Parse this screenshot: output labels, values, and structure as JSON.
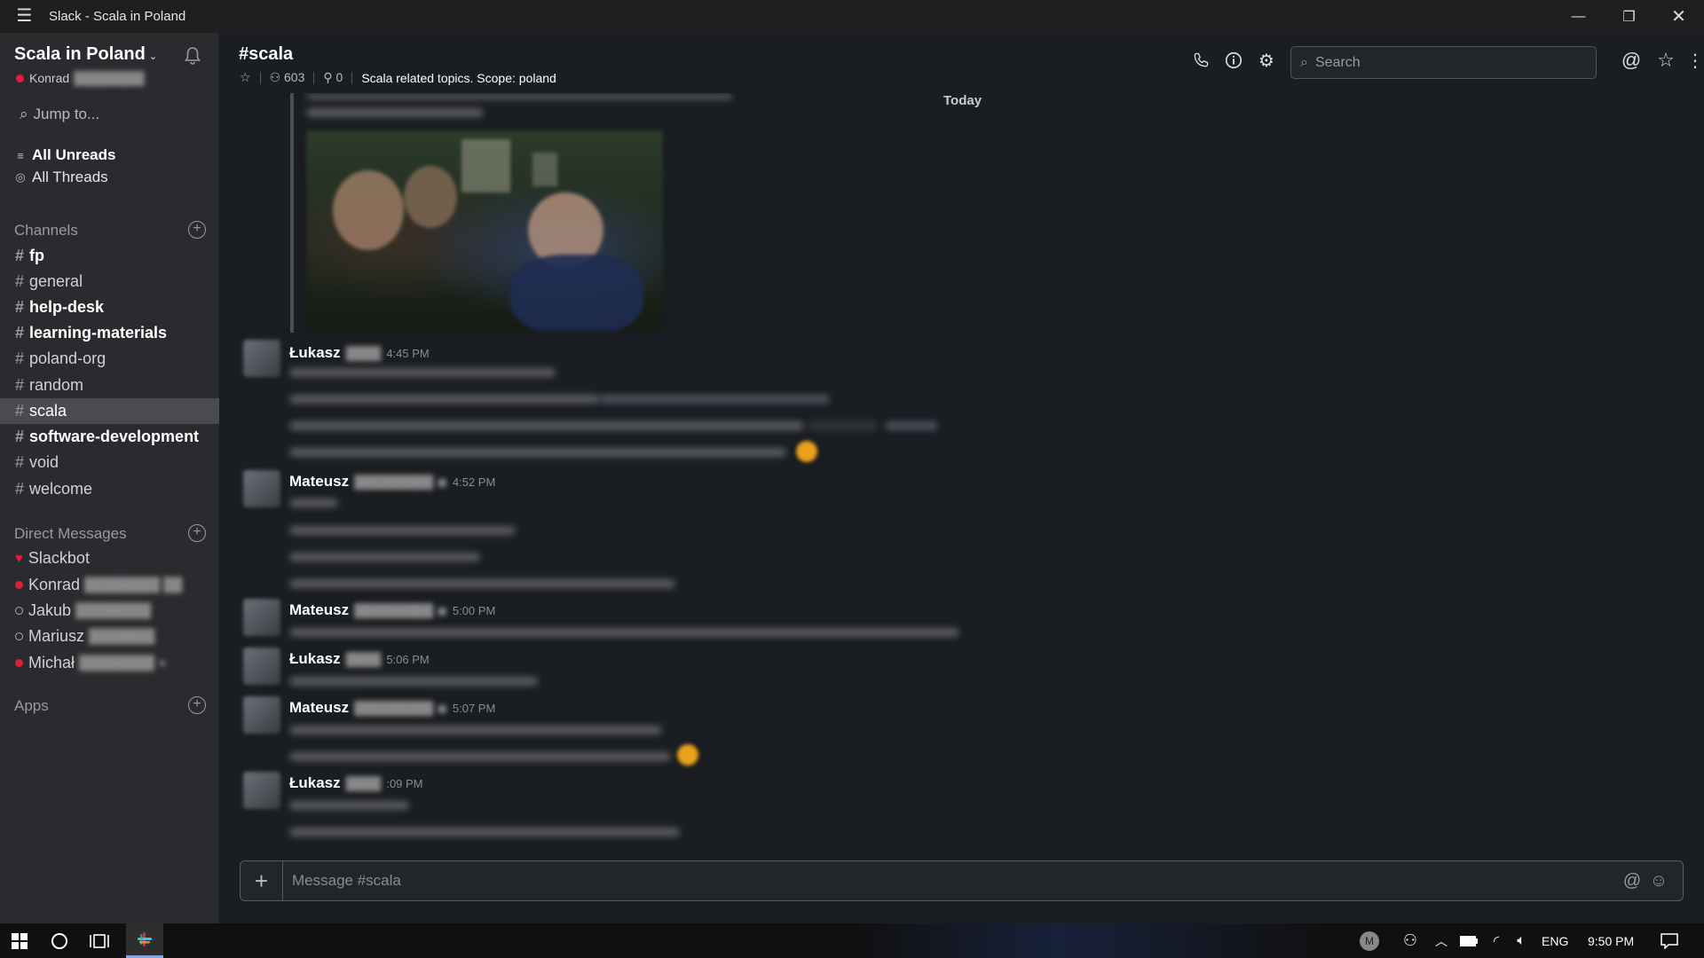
{
  "window": {
    "title": "Slack - Scala in Poland"
  },
  "team": {
    "name": "Scala in Poland",
    "current_user": "Konrad"
  },
  "sidebar": {
    "jump_label": "Jump to...",
    "all_unreads": "All Unreads",
    "all_threads": "All Threads",
    "channels_header": "Channels",
    "channels": [
      {
        "name": "fp"
      },
      {
        "name": "general"
      },
      {
        "name": "help-desk"
      },
      {
        "name": "learning-materials"
      },
      {
        "name": "poland-org"
      },
      {
        "name": "random"
      },
      {
        "name": "scala"
      },
      {
        "name": "software-development"
      },
      {
        "name": "void"
      },
      {
        "name": "welcome"
      }
    ],
    "dm_header": "Direct Messages",
    "dms": [
      {
        "name": "Slackbot"
      },
      {
        "name": "Konrad"
      },
      {
        "name": "Jakub"
      },
      {
        "name": "Mariusz"
      },
      {
        "name": "Michał"
      }
    ],
    "apps_header": "Apps"
  },
  "header": {
    "channel": "#scala",
    "members": "603",
    "pins": "0",
    "topic": "Scala related topics. Scope: poland",
    "search_placeholder": "Search"
  },
  "messages": {
    "day_divider": "Today",
    "items": [
      {
        "author": "Łukasz",
        "time": "4:45 PM"
      },
      {
        "author": "Mateusz",
        "time": "4:52 PM"
      },
      {
        "author": "Mateusz",
        "time": "5:00 PM"
      },
      {
        "author": "Łukasz",
        "time": "5:06 PM"
      },
      {
        "author": "Mateusz",
        "time": "5:07 PM"
      },
      {
        "author": "Łukasz",
        "time": ":09 PM"
      }
    ]
  },
  "composer": {
    "placeholder": "Message #scala"
  },
  "taskbar": {
    "avatar_letter": "M",
    "language": "ENG",
    "clock": "9:50 PM"
  }
}
